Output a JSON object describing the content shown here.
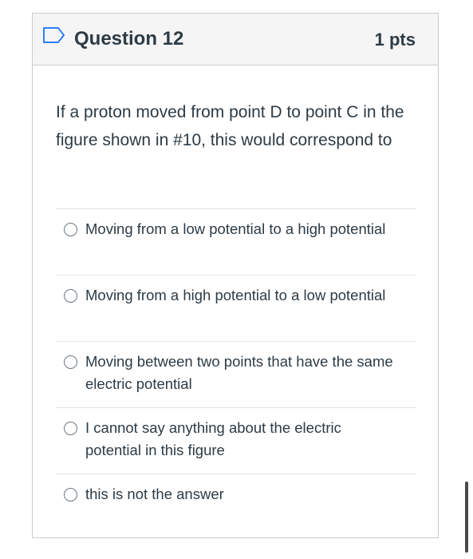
{
  "question": {
    "title": "Question 12",
    "points": "1 pts",
    "flag_icon": "bookmark-flag-icon",
    "text": "If a proton moved from point D to point C in the figure shown in #10, this would correspond to",
    "answers": [
      {
        "label": "Moving from a low potential to a high potential"
      },
      {
        "label": "Moving from a high potential to a low potential"
      },
      {
        "label": "Moving between two points that have the same electric potential"
      },
      {
        "label": "I cannot say anything about the electric potential in this figure"
      },
      {
        "label": "this is not the answer"
      }
    ]
  },
  "colors": {
    "header_bg": "#f5f5f5",
    "text": "#2d3b45",
    "flag_stroke": "#2d7ff9",
    "border": "#c7cdd1"
  }
}
